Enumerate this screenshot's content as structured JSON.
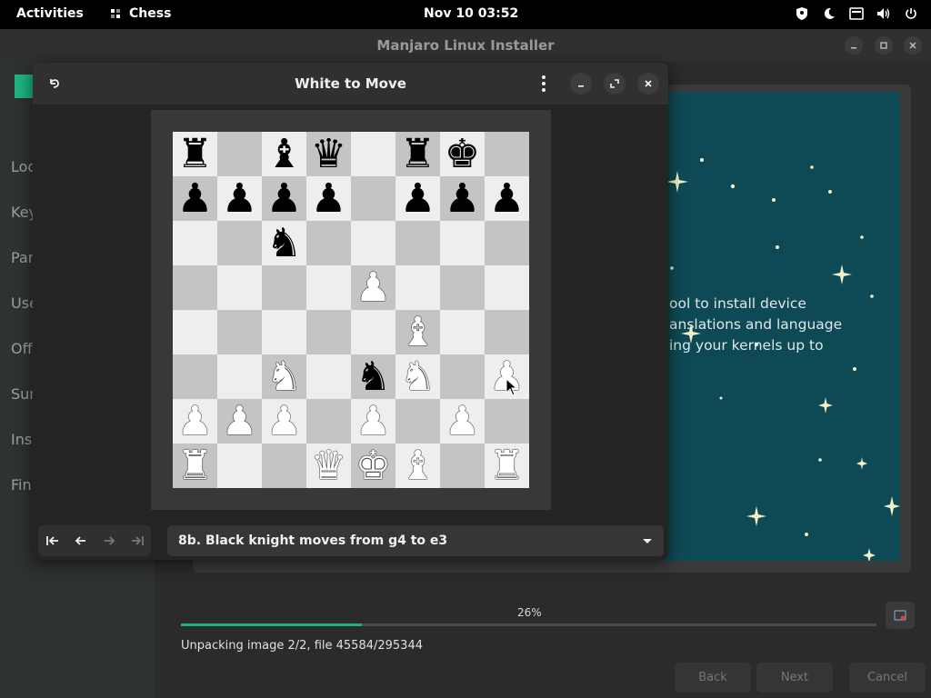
{
  "topbar": {
    "activities": "Activities",
    "app_name": "Chess",
    "clock": "Nov 10  03:52",
    "tray_icons": [
      "shield-icon",
      "night-light-icon",
      "keyboard-icon",
      "volume-icon",
      "power-icon"
    ]
  },
  "installer": {
    "title": "Manjaro Linux Installer",
    "sidebar_items": [
      "Loc",
      "Key",
      "Par",
      "Use",
      "Off",
      "Sun",
      "Ins",
      "Fin"
    ],
    "slide_lines": [
      "ool to install device",
      "anslations and language",
      "ing your kernels up to"
    ],
    "progress_percent": "26%",
    "progress_value": 0.26,
    "status": "Unpacking image 2/2, file 45584/295344",
    "buttons": {
      "back": "Back",
      "next": "Next",
      "cancel": "Cancel"
    },
    "colors": {
      "accent": "#1fb08a",
      "slide_bg": "#0e4a55"
    }
  },
  "chess": {
    "title": "White to Move",
    "board": [
      [
        "br",
        "",
        "bb",
        "bq",
        "",
        "br",
        "bk",
        ""
      ],
      [
        "bp",
        "bp",
        "bp",
        "bp",
        "",
        "bp",
        "bp",
        "bp"
      ],
      [
        "",
        "",
        "bn",
        "",
        "",
        "",
        "",
        ""
      ],
      [
        "",
        "",
        "",
        "",
        "wp",
        "",
        "",
        ""
      ],
      [
        "",
        "",
        "",
        "",
        "",
        "wb",
        "",
        ""
      ],
      [
        "",
        "",
        "wn",
        "",
        "bn",
        "wn",
        "",
        "wp"
      ],
      [
        "wp",
        "wp",
        "wp",
        "",
        "wp",
        "",
        "wp",
        ""
      ],
      [
        "wr",
        "",
        "",
        "wq",
        "wk",
        "wb",
        "",
        "wr"
      ]
    ],
    "move_text": "8b. Black knight moves from g4 to e3",
    "nav_icons": [
      "first-move-icon",
      "previous-move-icon",
      "next-move-icon",
      "last-move-icon"
    ]
  }
}
